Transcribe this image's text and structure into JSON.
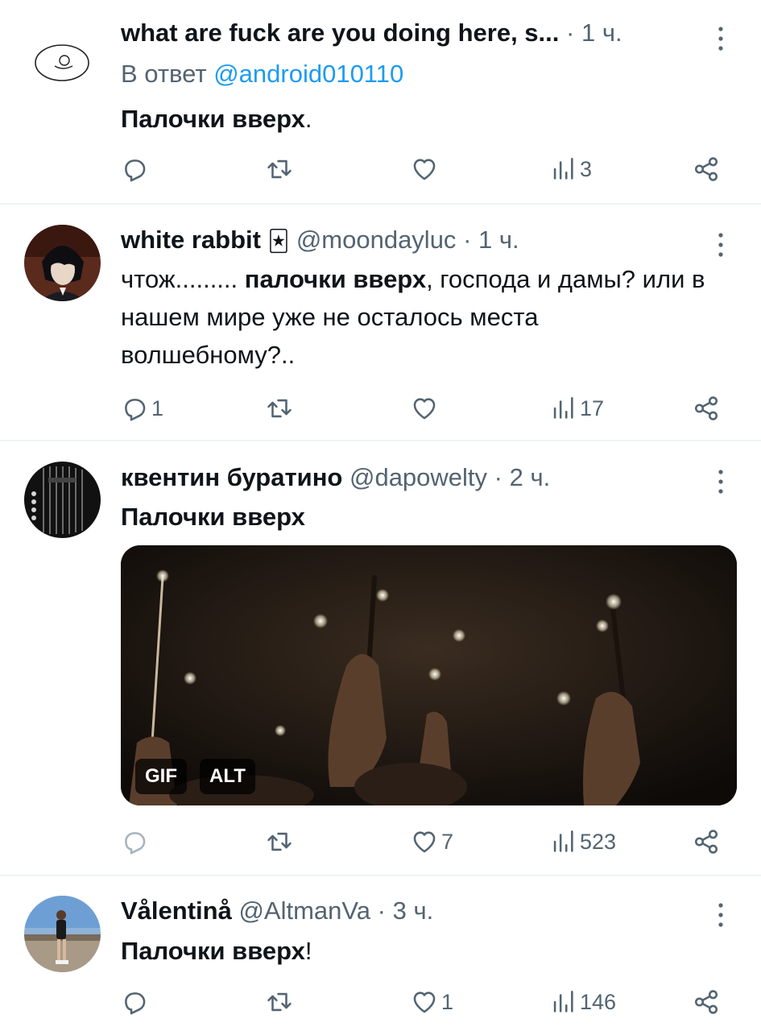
{
  "tweets": [
    {
      "name": "what are fuck are you doing here, s...",
      "handle": "",
      "time": "1 ч.",
      "reply_prefix": "В ответ",
      "reply_handle": "@android010110",
      "text_bold": "Палочки вверх",
      "text_after": ".",
      "stats": {
        "replies": "",
        "retweets": "",
        "likes": "",
        "views": "3"
      }
    },
    {
      "name": "white rabbit",
      "emoji": "🃏",
      "handle": "@moondayluc",
      "time": "1 ч.",
      "text_before": "чтож......... ",
      "text_bold": "палочки вверх",
      "text_after": ", господа и дамы? или в нашем мире уже не осталось места волшебному?..",
      "stats": {
        "replies": "1",
        "retweets": "",
        "likes": "",
        "views": "17"
      }
    },
    {
      "name": "квентин буратино",
      "handle": "@dapowelty",
      "time": "2 ч.",
      "text_bold": "Палочки вверх",
      "media": {
        "badge_gif": "GIF",
        "badge_alt": "ALT"
      },
      "stats": {
        "replies": "",
        "retweets": "",
        "likes": "7",
        "views": "523"
      }
    },
    {
      "name": "Vålentinå",
      "handle": "@AltmanVa",
      "time": "3 ч.",
      "text_bold": "Палочки вверх",
      "text_after": "!",
      "stats": {
        "replies": "",
        "retweets": "",
        "likes": "1",
        "views": "146"
      }
    }
  ],
  "separator": "·",
  "icons": [
    "reply-icon",
    "retweet-icon",
    "like-icon",
    "views-icon",
    "share-icon",
    "more-icon"
  ],
  "colors": {
    "text": "#0f1419",
    "secondary": "#536471",
    "link": "#1d9bf0",
    "divider": "#eff3f4"
  }
}
